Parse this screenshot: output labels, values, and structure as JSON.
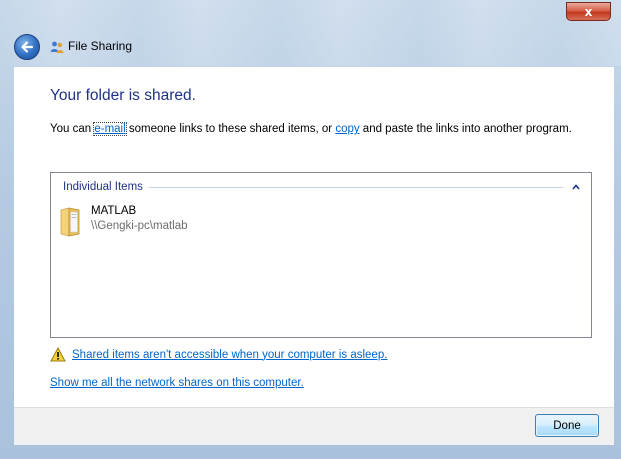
{
  "window": {
    "title": "File Sharing",
    "close_label": "x"
  },
  "main": {
    "heading": "Your folder is shared.",
    "description": {
      "prefix": "You can ",
      "email_link": "e-mail",
      "middle": " someone links to these shared items, or ",
      "copy_link": "copy",
      "suffix": " and paste the links into another program."
    },
    "items_group": {
      "label": "Individual Items",
      "items": [
        {
          "name": "MATLAB",
          "path": "\\\\Gengki-pc\\matlab",
          "icon": "folder-icon"
        }
      ]
    },
    "warning_link": "Shared items aren't accessible when your computer is asleep.",
    "network_link": "Show me all the network shares on this computer."
  },
  "footer": {
    "done_label": "Done"
  },
  "colors": {
    "heading": "#1e3287",
    "link": "#0066cc",
    "close_red": "#c2381c"
  }
}
